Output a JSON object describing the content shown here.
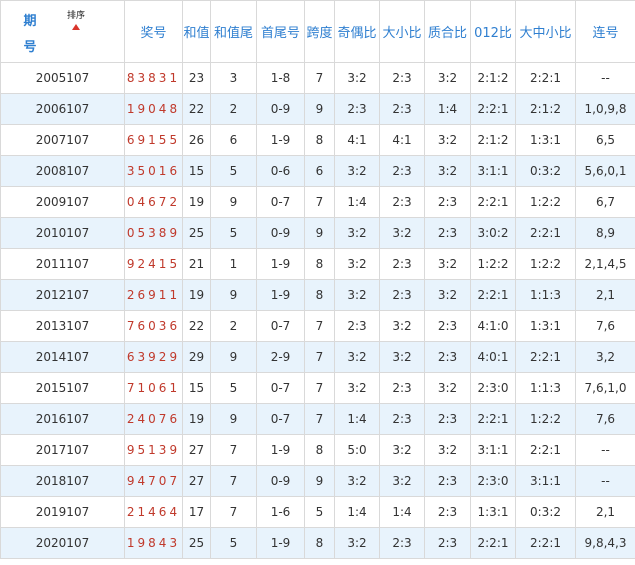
{
  "header": {
    "period_label": "期号",
    "sort_label": "排序",
    "columns": [
      "奖号",
      "和值",
      "和值尾",
      "首尾号",
      "跨度",
      "奇偶比",
      "大小比",
      "质合比",
      "012比",
      "大中小比",
      "连号"
    ]
  },
  "rows": [
    {
      "period": "2005107",
      "number": "83831",
      "sum": "23",
      "sum_tail": "3",
      "head_tail": "1-8",
      "span": "7",
      "odd_even": "3:2",
      "big_small": "2:3",
      "prime_composite": "3:2",
      "r012": "2:1:2",
      "big_mid_small": "2:2:1",
      "consecutive": "--"
    },
    {
      "period": "2006107",
      "number": "19048",
      "sum": "22",
      "sum_tail": "2",
      "head_tail": "0-9",
      "span": "9",
      "odd_even": "2:3",
      "big_small": "2:3",
      "prime_composite": "1:4",
      "r012": "2:2:1",
      "big_mid_small": "2:1:2",
      "consecutive": "1,0,9,8"
    },
    {
      "period": "2007107",
      "number": "69155",
      "sum": "26",
      "sum_tail": "6",
      "head_tail": "1-9",
      "span": "8",
      "odd_even": "4:1",
      "big_small": "4:1",
      "prime_composite": "3:2",
      "r012": "2:1:2",
      "big_mid_small": "1:3:1",
      "consecutive": "6,5"
    },
    {
      "period": "2008107",
      "number": "35016",
      "sum": "15",
      "sum_tail": "5",
      "head_tail": "0-6",
      "span": "6",
      "odd_even": "3:2",
      "big_small": "2:3",
      "prime_composite": "3:2",
      "r012": "3:1:1",
      "big_mid_small": "0:3:2",
      "consecutive": "5,6,0,1"
    },
    {
      "period": "2009107",
      "number": "04672",
      "sum": "19",
      "sum_tail": "9",
      "head_tail": "0-7",
      "span": "7",
      "odd_even": "1:4",
      "big_small": "2:3",
      "prime_composite": "2:3",
      "r012": "2:2:1",
      "big_mid_small": "1:2:2",
      "consecutive": "6,7"
    },
    {
      "period": "2010107",
      "number": "05389",
      "sum": "25",
      "sum_tail": "5",
      "head_tail": "0-9",
      "span": "9",
      "odd_even": "3:2",
      "big_small": "3:2",
      "prime_composite": "2:3",
      "r012": "3:0:2",
      "big_mid_small": "2:2:1",
      "consecutive": "8,9"
    },
    {
      "period": "2011107",
      "number": "92415",
      "sum": "21",
      "sum_tail": "1",
      "head_tail": "1-9",
      "span": "8",
      "odd_even": "3:2",
      "big_small": "2:3",
      "prime_composite": "3:2",
      "r012": "1:2:2",
      "big_mid_small": "1:2:2",
      "consecutive": "2,1,4,5"
    },
    {
      "period": "2012107",
      "number": "26911",
      "sum": "19",
      "sum_tail": "9",
      "head_tail": "1-9",
      "span": "8",
      "odd_even": "3:2",
      "big_small": "2:3",
      "prime_composite": "3:2",
      "r012": "2:2:1",
      "big_mid_small": "1:1:3",
      "consecutive": "2,1"
    },
    {
      "period": "2013107",
      "number": "76036",
      "sum": "22",
      "sum_tail": "2",
      "head_tail": "0-7",
      "span": "7",
      "odd_even": "2:3",
      "big_small": "3:2",
      "prime_composite": "2:3",
      "r012": "4:1:0",
      "big_mid_small": "1:3:1",
      "consecutive": "7,6"
    },
    {
      "period": "2014107",
      "number": "63929",
      "sum": "29",
      "sum_tail": "9",
      "head_tail": "2-9",
      "span": "7",
      "odd_even": "3:2",
      "big_small": "3:2",
      "prime_composite": "2:3",
      "r012": "4:0:1",
      "big_mid_small": "2:2:1",
      "consecutive": "3,2"
    },
    {
      "period": "2015107",
      "number": "71061",
      "sum": "15",
      "sum_tail": "5",
      "head_tail": "0-7",
      "span": "7",
      "odd_even": "3:2",
      "big_small": "2:3",
      "prime_composite": "3:2",
      "r012": "2:3:0",
      "big_mid_small": "1:1:3",
      "consecutive": "7,6,1,0"
    },
    {
      "period": "2016107",
      "number": "24076",
      "sum": "19",
      "sum_tail": "9",
      "head_tail": "0-7",
      "span": "7",
      "odd_even": "1:4",
      "big_small": "2:3",
      "prime_composite": "2:3",
      "r012": "2:2:1",
      "big_mid_small": "1:2:2",
      "consecutive": "7,6"
    },
    {
      "period": "2017107",
      "number": "95139",
      "sum": "27",
      "sum_tail": "7",
      "head_tail": "1-9",
      "span": "8",
      "odd_even": "5:0",
      "big_small": "3:2",
      "prime_composite": "3:2",
      "r012": "3:1:1",
      "big_mid_small": "2:2:1",
      "consecutive": "--"
    },
    {
      "period": "2018107",
      "number": "94707",
      "sum": "27",
      "sum_tail": "7",
      "head_tail": "0-9",
      "span": "9",
      "odd_even": "3:2",
      "big_small": "3:2",
      "prime_composite": "2:3",
      "r012": "2:3:0",
      "big_mid_small": "3:1:1",
      "consecutive": "--"
    },
    {
      "period": "2019107",
      "number": "21464",
      "sum": "17",
      "sum_tail": "7",
      "head_tail": "1-6",
      "span": "5",
      "odd_even": "1:4",
      "big_small": "1:4",
      "prime_composite": "2:3",
      "r012": "1:3:1",
      "big_mid_small": "0:3:2",
      "consecutive": "2,1"
    },
    {
      "period": "2020107",
      "number": "19843",
      "sum": "25",
      "sum_tail": "5",
      "head_tail": "1-9",
      "span": "8",
      "odd_even": "3:2",
      "big_small": "2:3",
      "prime_composite": "2:3",
      "r012": "2:2:1",
      "big_mid_small": "2:2:1",
      "consecutive": "9,8,4,3"
    }
  ]
}
